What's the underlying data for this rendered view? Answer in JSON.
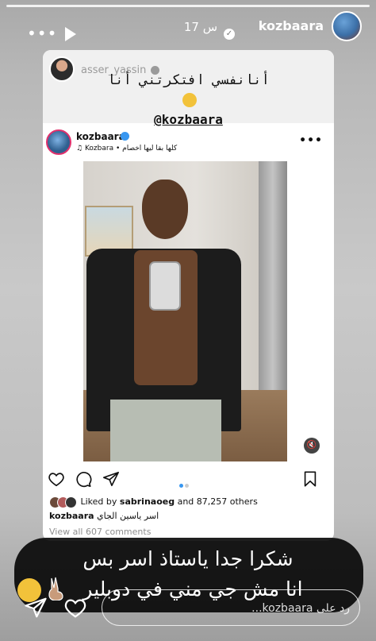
{
  "header": {
    "username": "kozbaara",
    "time": "17 س"
  },
  "original_post": {
    "username": "asser_yassin",
    "caption": "أنانفسي افتكرتني أنا",
    "mention": "@kozbaara"
  },
  "post": {
    "username": "kozbaara",
    "music": "Kozbara • كلها بقا ليها اخصام",
    "likes_prefix": "Liked by ",
    "likes_user": "sabrinaoeg",
    "likes_suffix": " and 87,257 others",
    "caption_user": "kozbaara",
    "caption_text": "اسر ياسين الجاي",
    "comments": "View all 607 comments"
  },
  "story_text": {
    "line1": "شكرا جدا ياستاذ اسر بس",
    "line2": "انا مش جي مني في دوبلير"
  },
  "reply": {
    "placeholder": "رد على kozbaara..."
  },
  "colors": {
    "verified_blue": "#3897f0",
    "story_ring": "#e1306c"
  }
}
